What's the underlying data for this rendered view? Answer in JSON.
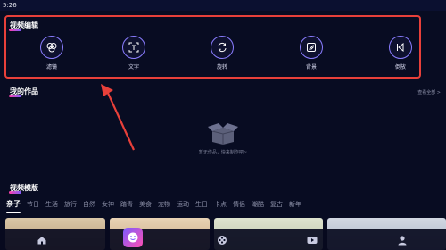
{
  "status_bar": {
    "time": "5:26"
  },
  "video_edit": {
    "title": "视频编辑",
    "tools": [
      {
        "label": "滤镜",
        "icon": "filter-icon"
      },
      {
        "label": "文字",
        "icon": "text-icon"
      },
      {
        "label": "旋转",
        "icon": "rotate-icon"
      },
      {
        "label": "背景",
        "icon": "background-icon"
      },
      {
        "label": "倒放",
        "icon": "reverse-play-icon"
      }
    ]
  },
  "my_works": {
    "title": "我的作品",
    "more_label": "查看全部 >",
    "empty_text": "暂无作品，快来制作吧~"
  },
  "templates": {
    "title": "视频模版",
    "categories": [
      "亲子",
      "节日",
      "生活",
      "旅行",
      "自然",
      "女神",
      "踏青",
      "美食",
      "宠物",
      "运动",
      "生日",
      "卡点",
      "情侣",
      "潮酷",
      "复古",
      "新年"
    ],
    "active_category": "亲子"
  },
  "bottom_nav": {
    "items": [
      {
        "label": "首页",
        "icon": "home-icon"
      },
      {
        "label": "",
        "icon": "avatar-icon"
      },
      {
        "label": "工具",
        "icon": "film-reel-icon"
      },
      {
        "label": "播放",
        "icon": "play-icon"
      },
      {
        "label": "我的",
        "icon": "profile-icon"
      }
    ]
  },
  "colors": {
    "background": "#080c22",
    "accent": "#8a7dff",
    "highlight_box": "#e8403a"
  }
}
